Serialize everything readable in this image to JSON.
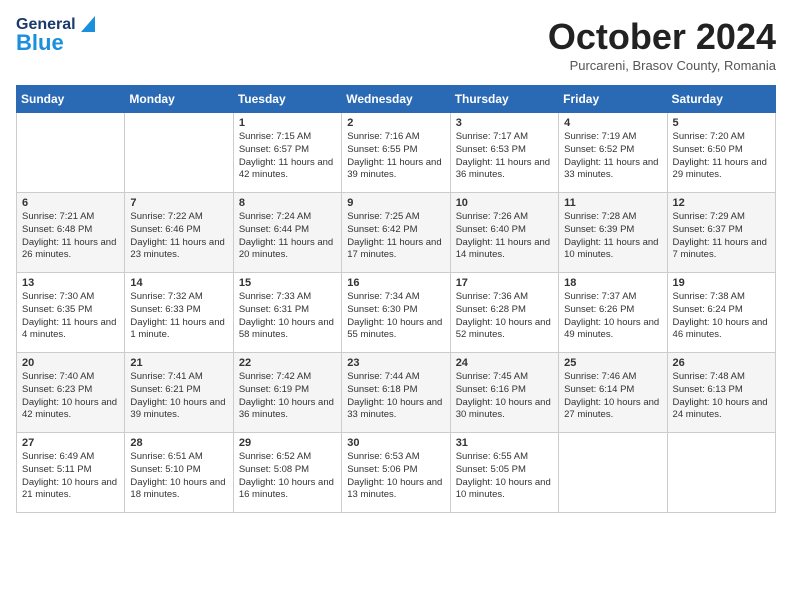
{
  "header": {
    "logo_general": "General",
    "logo_blue": "Blue",
    "month_title": "October 2024",
    "subtitle": "Purcareni, Brasov County, Romania"
  },
  "days_of_week": [
    "Sunday",
    "Monday",
    "Tuesday",
    "Wednesday",
    "Thursday",
    "Friday",
    "Saturday"
  ],
  "weeks": [
    [
      {
        "day": "",
        "sunrise": "",
        "sunset": "",
        "daylight": ""
      },
      {
        "day": "",
        "sunrise": "",
        "sunset": "",
        "daylight": ""
      },
      {
        "day": "1",
        "sunrise": "Sunrise: 7:15 AM",
        "sunset": "Sunset: 6:57 PM",
        "daylight": "Daylight: 11 hours and 42 minutes."
      },
      {
        "day": "2",
        "sunrise": "Sunrise: 7:16 AM",
        "sunset": "Sunset: 6:55 PM",
        "daylight": "Daylight: 11 hours and 39 minutes."
      },
      {
        "day": "3",
        "sunrise": "Sunrise: 7:17 AM",
        "sunset": "Sunset: 6:53 PM",
        "daylight": "Daylight: 11 hours and 36 minutes."
      },
      {
        "day": "4",
        "sunrise": "Sunrise: 7:19 AM",
        "sunset": "Sunset: 6:52 PM",
        "daylight": "Daylight: 11 hours and 33 minutes."
      },
      {
        "day": "5",
        "sunrise": "Sunrise: 7:20 AM",
        "sunset": "Sunset: 6:50 PM",
        "daylight": "Daylight: 11 hours and 29 minutes."
      }
    ],
    [
      {
        "day": "6",
        "sunrise": "Sunrise: 7:21 AM",
        "sunset": "Sunset: 6:48 PM",
        "daylight": "Daylight: 11 hours and 26 minutes."
      },
      {
        "day": "7",
        "sunrise": "Sunrise: 7:22 AM",
        "sunset": "Sunset: 6:46 PM",
        "daylight": "Daylight: 11 hours and 23 minutes."
      },
      {
        "day": "8",
        "sunrise": "Sunrise: 7:24 AM",
        "sunset": "Sunset: 6:44 PM",
        "daylight": "Daylight: 11 hours and 20 minutes."
      },
      {
        "day": "9",
        "sunrise": "Sunrise: 7:25 AM",
        "sunset": "Sunset: 6:42 PM",
        "daylight": "Daylight: 11 hours and 17 minutes."
      },
      {
        "day": "10",
        "sunrise": "Sunrise: 7:26 AM",
        "sunset": "Sunset: 6:40 PM",
        "daylight": "Daylight: 11 hours and 14 minutes."
      },
      {
        "day": "11",
        "sunrise": "Sunrise: 7:28 AM",
        "sunset": "Sunset: 6:39 PM",
        "daylight": "Daylight: 11 hours and 10 minutes."
      },
      {
        "day": "12",
        "sunrise": "Sunrise: 7:29 AM",
        "sunset": "Sunset: 6:37 PM",
        "daylight": "Daylight: 11 hours and 7 minutes."
      }
    ],
    [
      {
        "day": "13",
        "sunrise": "Sunrise: 7:30 AM",
        "sunset": "Sunset: 6:35 PM",
        "daylight": "Daylight: 11 hours and 4 minutes."
      },
      {
        "day": "14",
        "sunrise": "Sunrise: 7:32 AM",
        "sunset": "Sunset: 6:33 PM",
        "daylight": "Daylight: 11 hours and 1 minute."
      },
      {
        "day": "15",
        "sunrise": "Sunrise: 7:33 AM",
        "sunset": "Sunset: 6:31 PM",
        "daylight": "Daylight: 10 hours and 58 minutes."
      },
      {
        "day": "16",
        "sunrise": "Sunrise: 7:34 AM",
        "sunset": "Sunset: 6:30 PM",
        "daylight": "Daylight: 10 hours and 55 minutes."
      },
      {
        "day": "17",
        "sunrise": "Sunrise: 7:36 AM",
        "sunset": "Sunset: 6:28 PM",
        "daylight": "Daylight: 10 hours and 52 minutes."
      },
      {
        "day": "18",
        "sunrise": "Sunrise: 7:37 AM",
        "sunset": "Sunset: 6:26 PM",
        "daylight": "Daylight: 10 hours and 49 minutes."
      },
      {
        "day": "19",
        "sunrise": "Sunrise: 7:38 AM",
        "sunset": "Sunset: 6:24 PM",
        "daylight": "Daylight: 10 hours and 46 minutes."
      }
    ],
    [
      {
        "day": "20",
        "sunrise": "Sunrise: 7:40 AM",
        "sunset": "Sunset: 6:23 PM",
        "daylight": "Daylight: 10 hours and 42 minutes."
      },
      {
        "day": "21",
        "sunrise": "Sunrise: 7:41 AM",
        "sunset": "Sunset: 6:21 PM",
        "daylight": "Daylight: 10 hours and 39 minutes."
      },
      {
        "day": "22",
        "sunrise": "Sunrise: 7:42 AM",
        "sunset": "Sunset: 6:19 PM",
        "daylight": "Daylight: 10 hours and 36 minutes."
      },
      {
        "day": "23",
        "sunrise": "Sunrise: 7:44 AM",
        "sunset": "Sunset: 6:18 PM",
        "daylight": "Daylight: 10 hours and 33 minutes."
      },
      {
        "day": "24",
        "sunrise": "Sunrise: 7:45 AM",
        "sunset": "Sunset: 6:16 PM",
        "daylight": "Daylight: 10 hours and 30 minutes."
      },
      {
        "day": "25",
        "sunrise": "Sunrise: 7:46 AM",
        "sunset": "Sunset: 6:14 PM",
        "daylight": "Daylight: 10 hours and 27 minutes."
      },
      {
        "day": "26",
        "sunrise": "Sunrise: 7:48 AM",
        "sunset": "Sunset: 6:13 PM",
        "daylight": "Daylight: 10 hours and 24 minutes."
      }
    ],
    [
      {
        "day": "27",
        "sunrise": "Sunrise: 6:49 AM",
        "sunset": "Sunset: 5:11 PM",
        "daylight": "Daylight: 10 hours and 21 minutes."
      },
      {
        "day": "28",
        "sunrise": "Sunrise: 6:51 AM",
        "sunset": "Sunset: 5:10 PM",
        "daylight": "Daylight: 10 hours and 18 minutes."
      },
      {
        "day": "29",
        "sunrise": "Sunrise: 6:52 AM",
        "sunset": "Sunset: 5:08 PM",
        "daylight": "Daylight: 10 hours and 16 minutes."
      },
      {
        "day": "30",
        "sunrise": "Sunrise: 6:53 AM",
        "sunset": "Sunset: 5:06 PM",
        "daylight": "Daylight: 10 hours and 13 minutes."
      },
      {
        "day": "31",
        "sunrise": "Sunrise: 6:55 AM",
        "sunset": "Sunset: 5:05 PM",
        "daylight": "Daylight: 10 hours and 10 minutes."
      },
      {
        "day": "",
        "sunrise": "",
        "sunset": "",
        "daylight": ""
      },
      {
        "day": "",
        "sunrise": "",
        "sunset": "",
        "daylight": ""
      }
    ]
  ]
}
